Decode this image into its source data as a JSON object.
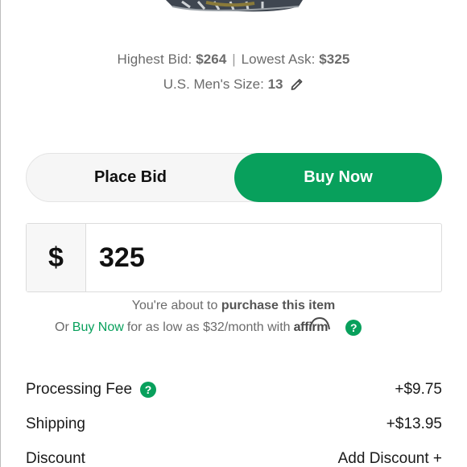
{
  "bids": {
    "highest_label": "Highest Bid:",
    "highest_value": "$264",
    "separator": "|",
    "lowest_label": "Lowest Ask:",
    "lowest_value": "$325"
  },
  "size": {
    "label": "U.S. Men's Size:",
    "value": "13",
    "edit_icon": "pencil-icon"
  },
  "toggle": {
    "place_bid": "Place Bid",
    "buy_now": "Buy Now",
    "active": "buy_now"
  },
  "price": {
    "currency": "$",
    "amount": "325"
  },
  "purchase_note": {
    "prefix": "You're about to",
    "emphasis": "purchase this item"
  },
  "affirm": {
    "prefix": "Or",
    "link": "Buy Now",
    "text": "for as low as $32/month with",
    "brand": "affirm",
    "help_icon": "question-icon"
  },
  "fees": [
    {
      "label": "Processing Fee",
      "value": "+$9.75",
      "has_help": true
    },
    {
      "label": "Shipping",
      "value": "+$13.95",
      "has_help": false
    },
    {
      "label": "Discount",
      "value": "Add Discount +",
      "has_help": false
    }
  ],
  "colors": {
    "accent": "#08a05c",
    "muted_text": "#6b6b6b"
  }
}
